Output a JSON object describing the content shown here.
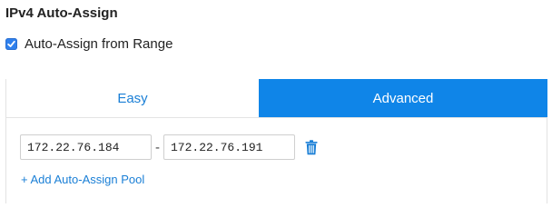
{
  "section": {
    "title": "IPv4 Auto-Assign"
  },
  "auto_assign_checkbox": {
    "label": "Auto-Assign from Range",
    "checked": true
  },
  "tabs": [
    {
      "label": "Easy",
      "active": false
    },
    {
      "label": "Advanced",
      "active": true
    }
  ],
  "range": {
    "start": "172.22.76.184",
    "separator": "-",
    "end": "172.22.76.191",
    "delete_icon": "trash-icon"
  },
  "add_pool_link": "+ Add Auto-Assign Pool",
  "colors": {
    "accent": "#0f85e8",
    "link": "#1a7fd6"
  }
}
